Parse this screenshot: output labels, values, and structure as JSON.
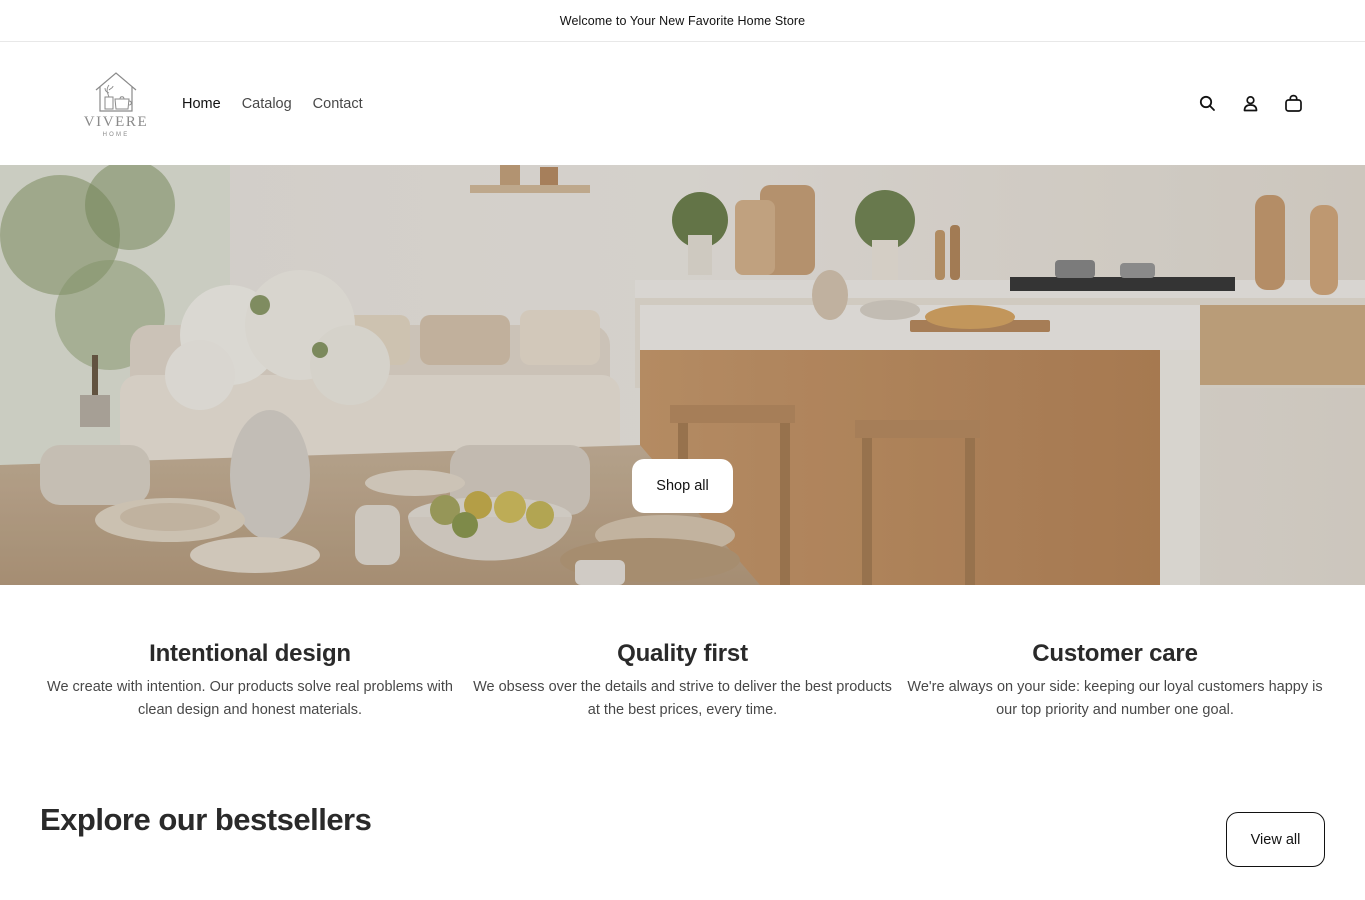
{
  "announcement": {
    "text": "Welcome to Your New Favorite Home Store"
  },
  "logo": {
    "name": "VIVERE",
    "subtitle": "HOME"
  },
  "nav": {
    "items": [
      {
        "label": "Home"
      },
      {
        "label": "Catalog"
      },
      {
        "label": "Contact"
      }
    ]
  },
  "header_icons": {
    "search": "search-icon",
    "account": "user-icon",
    "cart": "bag-icon"
  },
  "hero": {
    "button_label": "Shop all"
  },
  "features": [
    {
      "title": "Intentional design",
      "text": "We create with intention. Our products solve real problems with clean design and honest materials."
    },
    {
      "title": "Quality first",
      "text": "We obsess over the details and strive to deliver the best products at the best prices, every time."
    },
    {
      "title": "Customer care",
      "text": "We're always on your side: keeping our loyal customers happy is our top priority and number one goal."
    }
  ],
  "bestsellers": {
    "heading": "Explore our bestsellers",
    "view_all_label": "View all"
  },
  "colors": {
    "text": "#121212",
    "accent_wood": "#c9a27a",
    "background": "#ffffff"
  }
}
